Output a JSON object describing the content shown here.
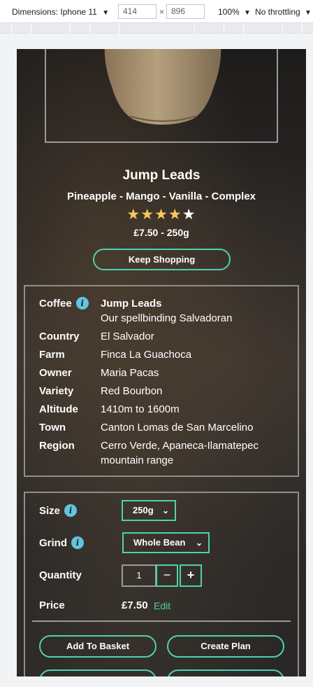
{
  "devtools": {
    "dimensions_label": "Dimensions: Iphone 11",
    "width": "414",
    "times": "×",
    "height": "896",
    "zoom": "100%",
    "throttling": "No throttling"
  },
  "product": {
    "name": "Jump Leads",
    "notes": "Pineapple - Mango - Vanilla - Complex",
    "rating": 4,
    "rating_max": 5,
    "price_weight": "£7.50 - 250g",
    "keep_shopping_label": "Keep Shopping"
  },
  "info": {
    "coffee_key": "Coffee",
    "coffee_name": "Jump Leads",
    "coffee_desc": "Our spellbinding Salvadoran",
    "country_key": "Country",
    "country": "El Salvador",
    "farm_key": "Farm",
    "farm": "Finca La Guachoca",
    "owner_key": "Owner",
    "owner": "Maria Pacas",
    "variety_key": "Variety",
    "variety": "Red Bourbon",
    "altitude_key": "Altitude",
    "altitude": "1410m to 1600m",
    "town_key": "Town",
    "town": "Canton Lomas de San Marcelino",
    "region_key": "Region",
    "region": "Cerro Verde, Apaneca-Ilamatepec mountain range"
  },
  "purchase": {
    "size_label": "Size",
    "size_value": "250g",
    "grind_label": "Grind",
    "grind_value": "Whole Bean",
    "quantity_label": "Quantity",
    "quantity_value": "1",
    "minus": "−",
    "plus": "+",
    "price_label": "Price",
    "price_value": "£7.50",
    "edit_label": "Edit",
    "add_to_basket": "Add To Basket",
    "create_plan": "Create Plan"
  },
  "colors": {
    "accent": "#4fd1b0",
    "info_icon": "#62c5e0",
    "star": "#f7c95a"
  }
}
